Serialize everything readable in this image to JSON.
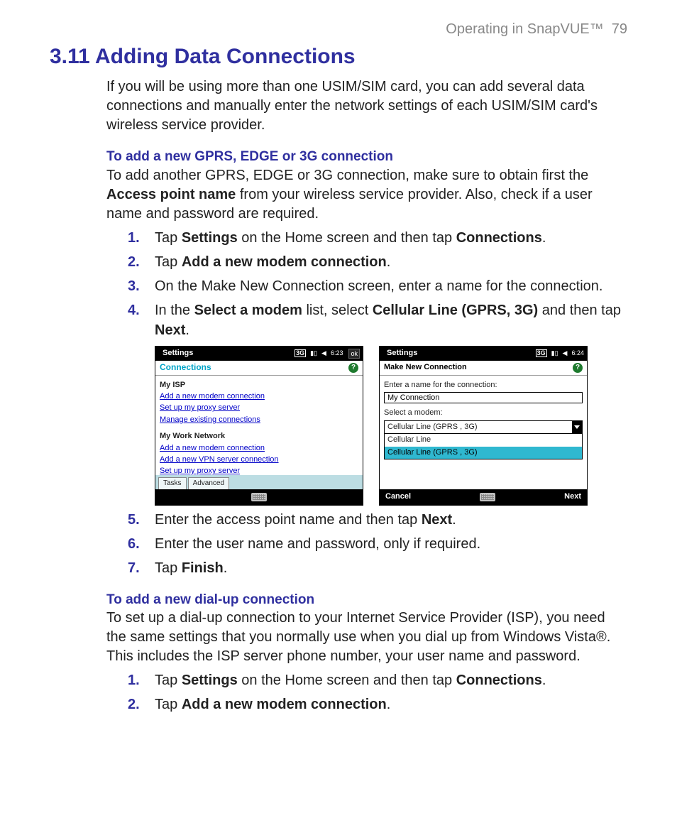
{
  "header": {
    "chapter": "Operating in SnapVUE™",
    "page": "79"
  },
  "title": "3.11  Adding Data Connections",
  "intro": "If you will be using more than one USIM/SIM card, you can add several data connections and manually enter the network settings of each USIM/SIM card's wireless service provider.",
  "sectionA": {
    "heading": "To add a new GPRS, EDGE or 3G connection",
    "para_pre": "To add another GPRS, EDGE or 3G connection, make sure to obtain first the ",
    "para_bold": "Access point name",
    "para_post": " from your wireless service provider. Also, check if a user name and password are required.",
    "step1_a": "Tap ",
    "step1_b": "Settings",
    "step1_c": " on the Home screen and then tap ",
    "step1_d": "Connections",
    "step1_e": ".",
    "step2_a": "Tap ",
    "step2_b": "Add a new modem connection",
    "step2_c": ".",
    "step3": "On the Make New Connection screen, enter a name for the connection.",
    "step4_a": "In the ",
    "step4_b": "Select a modem",
    "step4_c": " list, select ",
    "step4_d": "Cellular Line (GPRS, 3G)",
    "step4_e": " and then tap ",
    "step4_f": "Next",
    "step4_g": ".",
    "step5_a": "Enter the access point name and then tap ",
    "step5_b": "Next",
    "step5_c": ".",
    "step6": "Enter the user name and password, only if required.",
    "step7_a": "Tap ",
    "step7_b": "Finish",
    "step7_c": "."
  },
  "sectionB": {
    "heading": "To add a new dial-up connection",
    "para": "To set up a dial-up connection to your Internet Service Provider (ISP), you need the same settings that you normally use when you dial up from Windows Vista®. This includes the ISP server phone number, your user name and password.",
    "step1_a": "Tap ",
    "step1_b": "Settings",
    "step1_c": " on the Home screen and then tap ",
    "step1_d": "Connections",
    "step1_e": ".",
    "step2_a": "Tap ",
    "step2_b": "Add a new modem connection",
    "step2_c": "."
  },
  "shotL": {
    "topTitle": "Settings",
    "time": "6:23",
    "ok": "ok",
    "sub": "Connections",
    "grp1": "My ISP",
    "l1": "Add a new modem connection",
    "l2": "Set up my proxy server",
    "l3": "Manage existing connections",
    "grp2": "My Work Network",
    "l4": "Add a new modem connection",
    "l5": "Add a new VPN server connection",
    "l6": "Set up my proxy server",
    "tab1": "Tasks",
    "tab2": "Advanced"
  },
  "shotR": {
    "topTitle": "Settings",
    "time": "6:24",
    "sub": "Make New Connection",
    "lbl1": "Enter a name for the connection:",
    "val1": "My Connection",
    "lbl2": "Select a modem:",
    "ddval": "Cellular Line (GPRS , 3G)",
    "opt1": "Cellular Line",
    "opt2": "Cellular Line (GPRS , 3G)",
    "btnL": "Cancel",
    "btnR": "Next"
  },
  "icons": {
    "3g": "3G",
    "signal": "▮▯",
    "speaker": "◀",
    "help": "?"
  }
}
